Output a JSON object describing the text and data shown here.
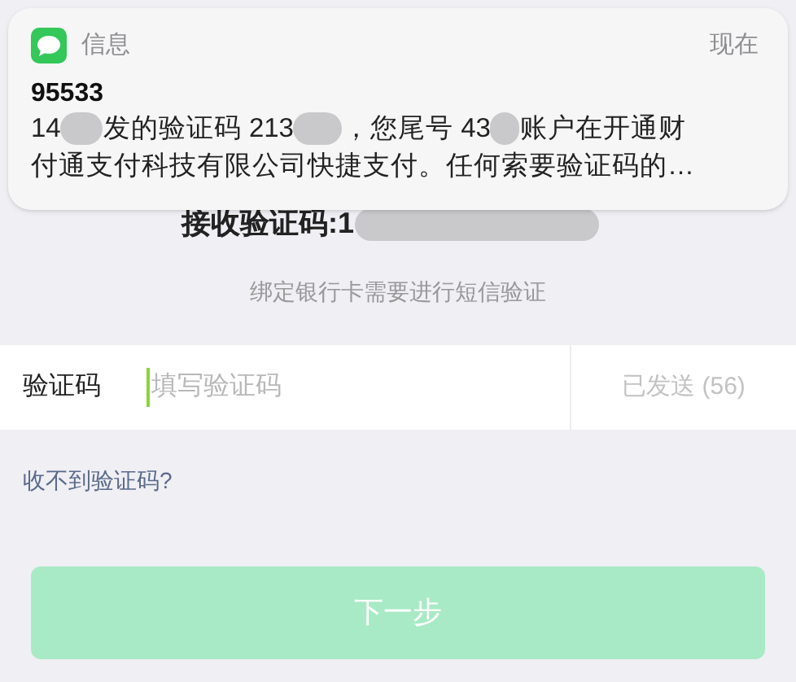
{
  "notification": {
    "app": "信息",
    "time": "现在",
    "sender": "95533",
    "message_lines": [
      [
        "14",
        "发的验证码 213",
        "，您尾号 43",
        "账户在开通财"
      ],
      [
        "付通支付科技有限公司快捷支付。任何索要验证码的…"
      ]
    ]
  },
  "heading_parts": [
    "接收验证码:1"
  ],
  "subtitle": "绑定银行卡需要进行短信验证",
  "code_field": {
    "label": "验证码",
    "placeholder": "填写验证码",
    "focused": true,
    "resend": "已发送 (56)",
    "resend_disabled": true
  },
  "help_link": "收不到验证码?",
  "next_button": {
    "label": "下一步",
    "disabled": true
  }
}
